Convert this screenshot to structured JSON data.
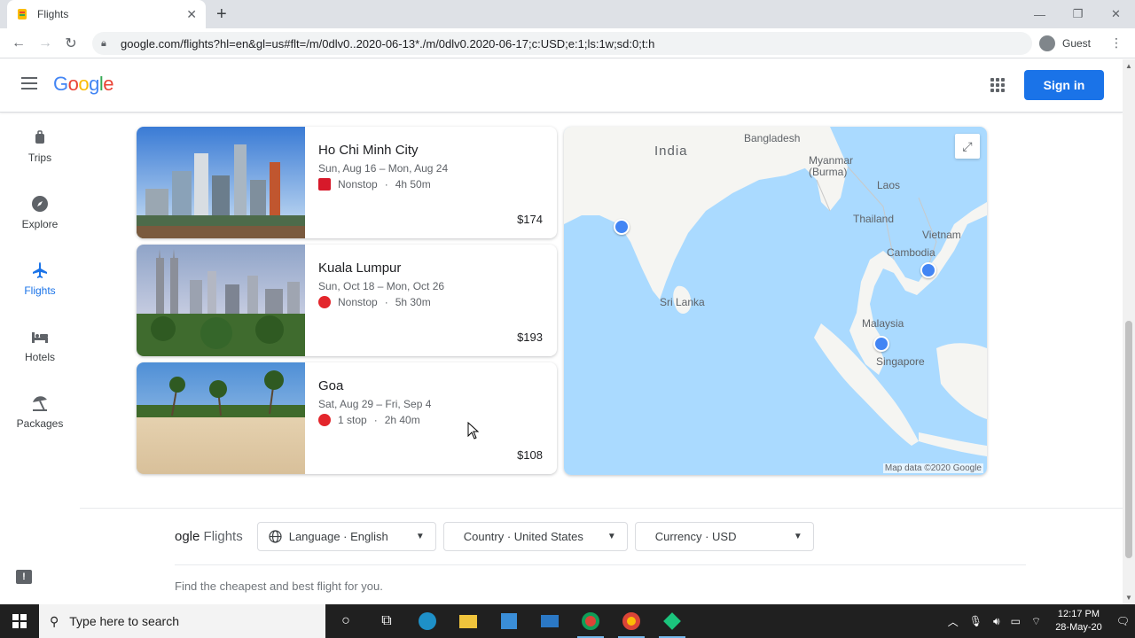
{
  "browser": {
    "tab_title": "Flights",
    "url": "google.com/flights?hl=en&gl=us#flt=/m/0dlv0..2020-06-13*./m/0dlv0.2020-06-17;c:USD;e:1;ls:1w;sd:0;t:h",
    "profile": "Guest"
  },
  "header": {
    "logo": "Google",
    "signin_label": "Sign in"
  },
  "sidenav": [
    {
      "label": "Trips",
      "icon": "trips-icon"
    },
    {
      "label": "Explore",
      "icon": "explore-icon"
    },
    {
      "label": "Flights",
      "icon": "flights-icon"
    },
    {
      "label": "Hotels",
      "icon": "hotels-icon"
    },
    {
      "label": "Packages",
      "icon": "packages-icon"
    }
  ],
  "destinations": [
    {
      "city": "Ho Chi Minh City",
      "dates": "Sun, Aug 16 – Mon, Aug 24",
      "stops": "Nonstop",
      "duration": "4h 50m",
      "price": "$174",
      "airline_color": "#d7192a"
    },
    {
      "city": "Kuala Lumpur",
      "dates": "Sun, Oct 18 – Mon, Oct 26",
      "stops": "Nonstop",
      "duration": "5h 30m",
      "price": "$193",
      "airline_color": "#e3262c"
    },
    {
      "city": "Goa",
      "dates": "Sat, Aug 29 – Fri, Sep 4",
      "stops": "1 stop",
      "duration": "2h 40m",
      "price": "$108",
      "airline_color": "#e3262c"
    }
  ],
  "map": {
    "labels": {
      "india": "India",
      "bangladesh": "Bangladesh",
      "myanmar": "Myanmar\n(Burma)",
      "laos": "Laos",
      "thailand": "Thailand",
      "vietnam": "Vietnam",
      "cambodia": "Cambodia",
      "sri_lanka": "Sri Lanka",
      "malaysia": "Malaysia",
      "singapore": "Singapore"
    },
    "credit": "Map data ©2020 Google",
    "water_color": "#aadaff",
    "land_color": "#f5f5f2"
  },
  "footer": {
    "logo_partial": "ogle",
    "logo_product": "Flights",
    "language": "Language · English",
    "country": "Country · United States",
    "currency": "Currency · USD",
    "tagline": "Find the cheapest and best flight for you."
  },
  "taskbar": {
    "search_placeholder": "Type here to search",
    "time": "12:17 PM",
    "date": "28-May-20"
  }
}
